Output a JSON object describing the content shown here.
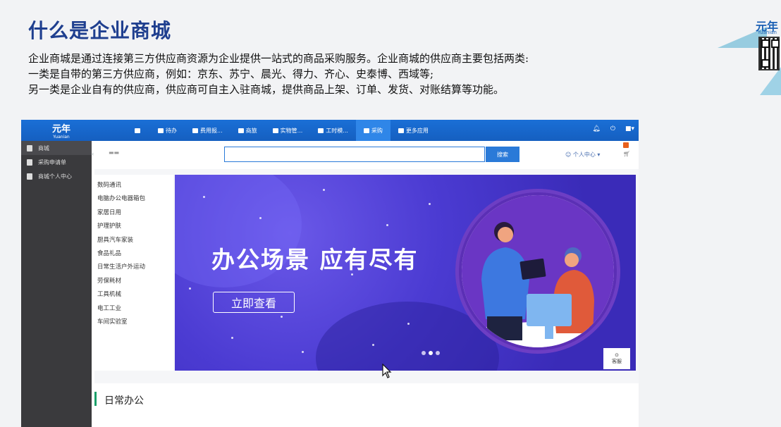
{
  "slide": {
    "title": "什么是企业商城",
    "lines": [
      "企业商城是通过连接第三方供应商资源为企业提供一站式的商品采购服务。企业商城的供应商主要包括两类:",
      "一类是自带的第三方供应商，例如：京东、苏宁、晨光、得力、齐心、史泰博、西域等;",
      "另一类是企业自有的供应商，供应商可自主入驻商城，提供商品上架、订单、发货、对账结算等功能。"
    ],
    "brand": "元年",
    "brand_sub": "Yuanian"
  },
  "app": {
    "logo": "元年",
    "logo_sub": "Yuanian",
    "nav": [
      {
        "label": "",
        "icon": "home-icon"
      },
      {
        "label": "待办",
        "icon": "todo-icon"
      },
      {
        "label": "费用报...",
        "icon": "expense-icon"
      },
      {
        "label": "商旅",
        "icon": "travel-icon"
      },
      {
        "label": "实物管...",
        "icon": "asset-icon"
      },
      {
        "label": "工时模...",
        "icon": "timesheet-icon"
      },
      {
        "label": "采购",
        "icon": "purchase-icon"
      },
      {
        "label": "更多应用",
        "icon": "apps-icon"
      }
    ],
    "sidebar": [
      {
        "label": "商城"
      },
      {
        "label": "采购申请单"
      },
      {
        "label": "商城个人中心"
      }
    ],
    "search_button": "搜索",
    "user_center": "个人中心",
    "categories": [
      "数码通讯",
      "电脑办公电器箱包",
      "家居日用",
      "护理护肤",
      "厨具汽车家装",
      "食品礼品",
      "日常生活户外运动",
      "劳保耗材",
      "工具机械",
      "电工工业",
      "车间实验室"
    ],
    "banner": {
      "title": "办公场景 应有尽有",
      "button": "立即查看"
    },
    "service": "客服",
    "section_title": "日常办公"
  },
  "colors": {
    "title_blue": "#1f3f8f",
    "nav_blue": "#1a6fd6",
    "banner_purple": "#4b3bd2"
  }
}
